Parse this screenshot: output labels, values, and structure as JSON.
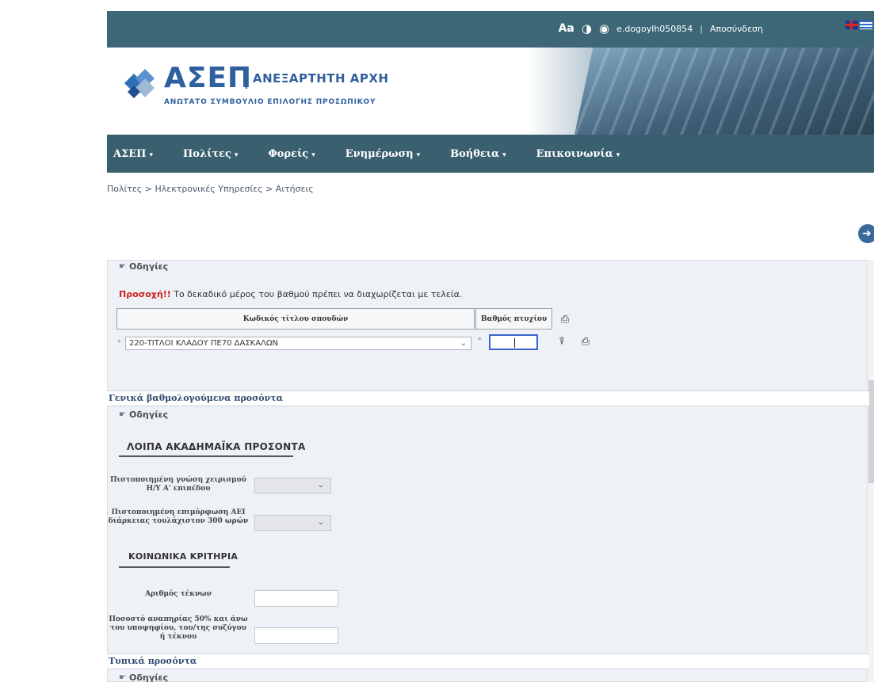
{
  "topbar": {
    "font_size_label": "Aa",
    "contrast_icon": "contrast-icon",
    "view_icon": "eye-icon",
    "username": "e.dogoylh050854",
    "separator": "|",
    "logout": "Αποσύνδεση",
    "languages": [
      "English",
      "Ελληνικά"
    ]
  },
  "header": {
    "logo_title": "ΑΣΕΠ",
    "logo_subtitle": "ΑΝΕΞΑΡΤΗΤΗ ΑΡΧΗ",
    "logo_tagline": "ΑΝΩΤΑΤΟ ΣΥΜΒΟΥΛΙΟ ΕΠΙΛΟΓΗΣ ΠΡΟΣΩΠΙΚΟΥ"
  },
  "nav": {
    "items": [
      {
        "label": "ΑΣΕΠ"
      },
      {
        "label": "Πολίτες"
      },
      {
        "label": "Φορείς"
      },
      {
        "label": "Ενημέρωση"
      },
      {
        "label": "Βοήθεια"
      },
      {
        "label": "Επικοινωνία"
      }
    ],
    "caret": "▾"
  },
  "breadcrumb": "Πολίτες > Ηλεκτρονικές Υπηρεσίες > Αιτήσεις",
  "back_icon": "back-arrow-icon",
  "form": {
    "guide_label": "Οδηγίες",
    "warning_strong": "Προσοχή!!",
    "warning_text": " Το δεκαδικό μέρος του βαθμού πρέπει να διαχωρίζεται με τελεία.",
    "col_degree_code": "Κωδικός τίτλου σπουδών",
    "col_degree_grade": "Βαθμός πτυχίου",
    "required_mark": "*",
    "degree_value": "220-ΤΙΤΛΟΙ ΚΛΑΔΟΥ ΠΕ70 ΔΑΣΚΑΛΩΝ",
    "grade_value": "",
    "section_general": "Γενικά βαθμολογούμενα προσόντα",
    "heading_academic": "ΛΟΙΠΑ ΑΚΑΔΗΜΑΪΚΑ ΠΡΟΣΟΝΤΑ",
    "label_computer": "Πιστοποιημένη γνώση χειρισμού Η/Υ Α' επιπέδου",
    "label_training": "Πιστοποιημένη επιμόρφωση ΑΕΙ διάρκειας τουλάχιστον 300 ωρών",
    "heading_social": "ΚΟΙΝΩΝΙΚΑ ΚΡΙΤΗΡΙΑ",
    "label_children": "Αριθμός τέκνων",
    "label_disability": "Ποσοστό αναπηρίας 50% και άνω του υποψηφίου, του/της συζύγου ή τέκνου",
    "section_typical": "Τυπικά προσόντα"
  }
}
